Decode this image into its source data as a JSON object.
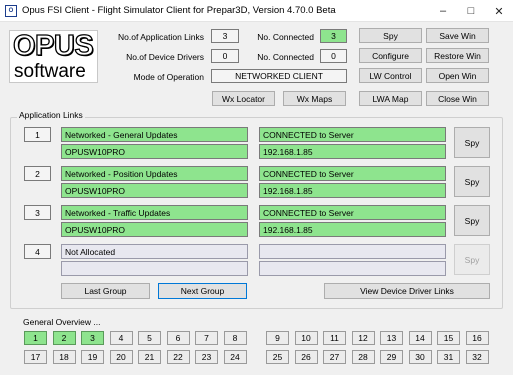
{
  "window": {
    "title": "Opus FSI Client - Flight Simulator Client for Prepar3D, Version 4.70.0 Beta",
    "minimize_glyph": "–",
    "maximize_glyph": "□",
    "close_glyph": "✕",
    "icon_text": "O"
  },
  "logo": {
    "line1": "OPUS",
    "line2": "software"
  },
  "stats": {
    "app_links_label": "No.of Application Links",
    "app_links_value": "3",
    "device_drivers_label": "No.of Device Drivers",
    "device_drivers_value": "0",
    "mode_label": "Mode of Operation",
    "mode_value": "NETWORKED CLIENT",
    "connected1_label": "No. Connected",
    "connected1_value": "3",
    "connected2_label": "No. Connected",
    "connected2_value": "0"
  },
  "buttons": {
    "spy": "Spy",
    "save_win": "Save Win",
    "configure": "Configure",
    "restore_win": "Restore Win",
    "lw_control": "LW Control",
    "open_win": "Open Win",
    "wx_locator": "Wx Locator",
    "wx_maps": "Wx Maps",
    "lwa_map": "LWA Map",
    "close_win": "Close Win"
  },
  "app_links": {
    "group_label": "Application Links",
    "rows": [
      {
        "num": "1",
        "name": "Networked - General Updates",
        "host": "OPUSW10PRO",
        "status": "CONNECTED to Server",
        "ip": "192.168.1.85",
        "spy": "Spy"
      },
      {
        "num": "2",
        "name": "Networked - Position Updates",
        "host": "OPUSW10PRO",
        "status": "CONNECTED to Server",
        "ip": "192.168.1.85",
        "spy": "Spy"
      },
      {
        "num": "3",
        "name": "Networked - Traffic Updates",
        "host": "OPUSW10PRO",
        "status": "CONNECTED to Server",
        "ip": "192.168.1.85",
        "spy": "Spy"
      },
      {
        "num": "4",
        "name": "Not Allocated",
        "host": "",
        "status": "",
        "ip": "",
        "spy": "Spy"
      }
    ],
    "last_group": "Last Group",
    "next_group": "Next Group",
    "view_drivers": "View Device Driver Links"
  },
  "overview": {
    "label": "General Overview ...",
    "row1_left": [
      "1",
      "2",
      "3",
      "4",
      "5",
      "6",
      "7",
      "8"
    ],
    "row1_right": [
      "9",
      "10",
      "11",
      "12",
      "13",
      "14",
      "15",
      "16"
    ],
    "row2_left": [
      "17",
      "18",
      "19",
      "20",
      "21",
      "22",
      "23",
      "24"
    ],
    "row2_right": [
      "25",
      "26",
      "27",
      "28",
      "29",
      "30",
      "31",
      "32"
    ],
    "active": [
      "1",
      "2",
      "3"
    ]
  },
  "colors": {
    "connected_green": "#8ee48e",
    "focus_blue": "#0078d7"
  }
}
